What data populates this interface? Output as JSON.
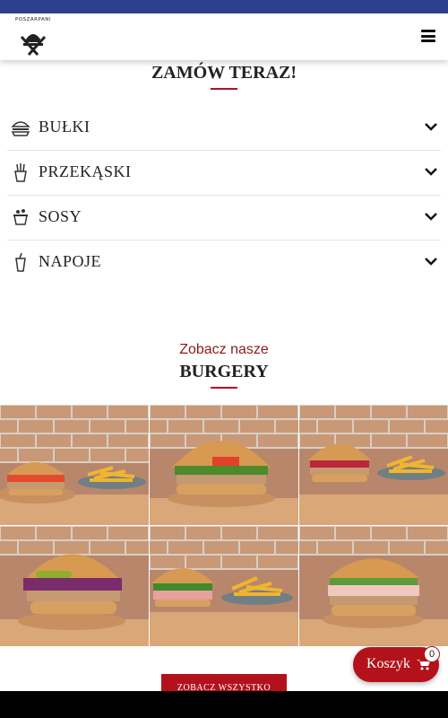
{
  "brand": {
    "logo_text": "POSZARPANI"
  },
  "order": {
    "title": "ZAMÓW TERAZ!"
  },
  "menu": {
    "items": [
      {
        "label": "BUŁKI",
        "icon": "burger-icon"
      },
      {
        "label": "PRZEKĄSKI",
        "icon": "fries-icon"
      },
      {
        "label": "SOSY",
        "icon": "sauce-icon"
      },
      {
        "label": "NAPOJE",
        "icon": "drink-icon"
      }
    ]
  },
  "burgers": {
    "subtitle": "Zobacz nasze",
    "title": "BURGERY",
    "see_all_label": "ZOBACZ WSZYSTKO",
    "photos": [
      {
        "name": "burger with fries"
      },
      {
        "name": "burger with arugula"
      },
      {
        "name": "burger with fries"
      },
      {
        "name": "burger with red cabbage"
      },
      {
        "name": "burger with fries"
      },
      {
        "name": "burger with prosciutto"
      }
    ]
  },
  "cart": {
    "label": "Koszyk",
    "count": "0"
  },
  "colors": {
    "accent": "#b3121b",
    "top_bar": "#2f3f8f",
    "subtitle": "#8b1a1a"
  }
}
